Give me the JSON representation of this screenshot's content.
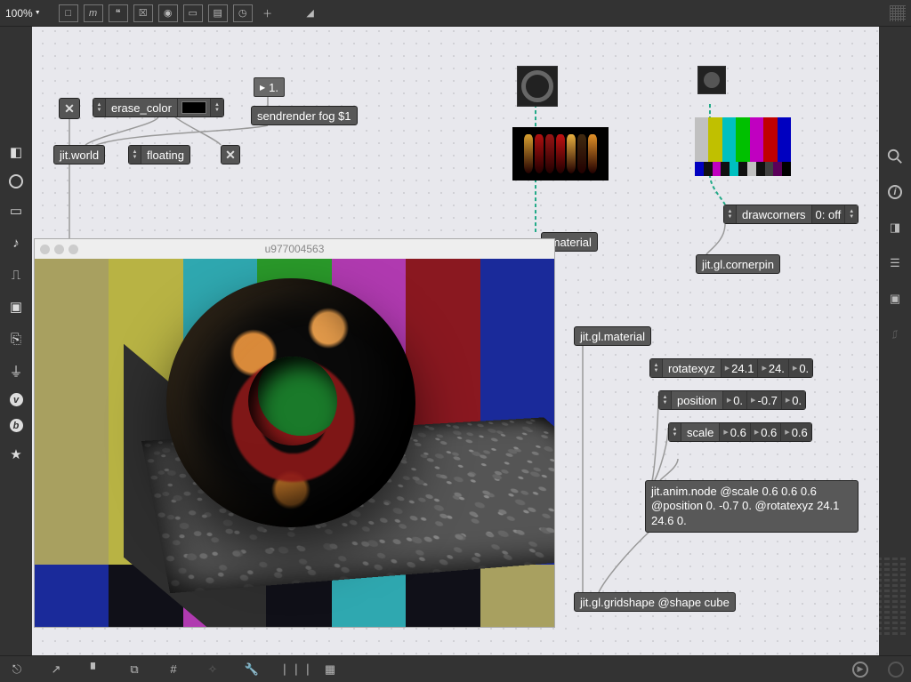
{
  "topbar": {
    "zoom": "100%"
  },
  "toggles": {
    "main": "✕",
    "floating": "✕"
  },
  "attr": {
    "erase_color": {
      "label": "erase_color"
    },
    "floating": {
      "label": "floating"
    },
    "drawcorners": {
      "label": "drawcorners",
      "value": "0: off"
    },
    "rotatexyz": {
      "label": "rotatexyz",
      "v1": "24.1",
      "v2": "24.",
      "v3": "0."
    },
    "position": {
      "label": "position",
      "v1": "0.",
      "v2": "-0.7",
      "v3": "0."
    },
    "scale": {
      "label": "scale",
      "v1": "0.6",
      "v2": "0.6",
      "v3": "0.6"
    }
  },
  "objects": {
    "jitworld": "jit.world",
    "sendrender": "sendrender fog $1",
    "material1": ".material",
    "material2": "jit.gl.material",
    "cornerpin": "jit.gl.cornerpin",
    "animnode": "jit.anim.node @scale 0.6 0.6 0.6 @position 0. -0.7 0. @rotatexyz 24.1 24.6 0.",
    "gridshape": "jit.gl.gridshape @shape cube"
  },
  "msg": {
    "one": "1."
  },
  "window": {
    "title": "u977004563"
  },
  "colors": {
    "bars": [
      "#a8a060",
      "#b8b344",
      "#2fa8b0",
      "#2a9a2a",
      "#b03ab0",
      "#8a1820",
      "#1a2a9a"
    ],
    "bars2": [
      "#1a2a9a",
      "#101018",
      "#b03ab0",
      "#101018",
      "#2fa8b0",
      "#101018",
      "#a8a060"
    ],
    "smpte_top": [
      "#c0c0c0",
      "#c0c000",
      "#00c0c0",
      "#00c000",
      "#c000c0",
      "#c00000",
      "#0000c0"
    ],
    "smpte_bot": [
      "#0000c0",
      "#101010",
      "#c000c0",
      "#101010",
      "#00c0c0",
      "#101010",
      "#c0c0c0",
      "#101010",
      "#404040",
      "#5a005a",
      "#000000"
    ],
    "chilis": [
      "#d8a030",
      "#b01010",
      "#981414",
      "#c01212",
      "#e8b040",
      "#402a10",
      "#e09028"
    ]
  }
}
